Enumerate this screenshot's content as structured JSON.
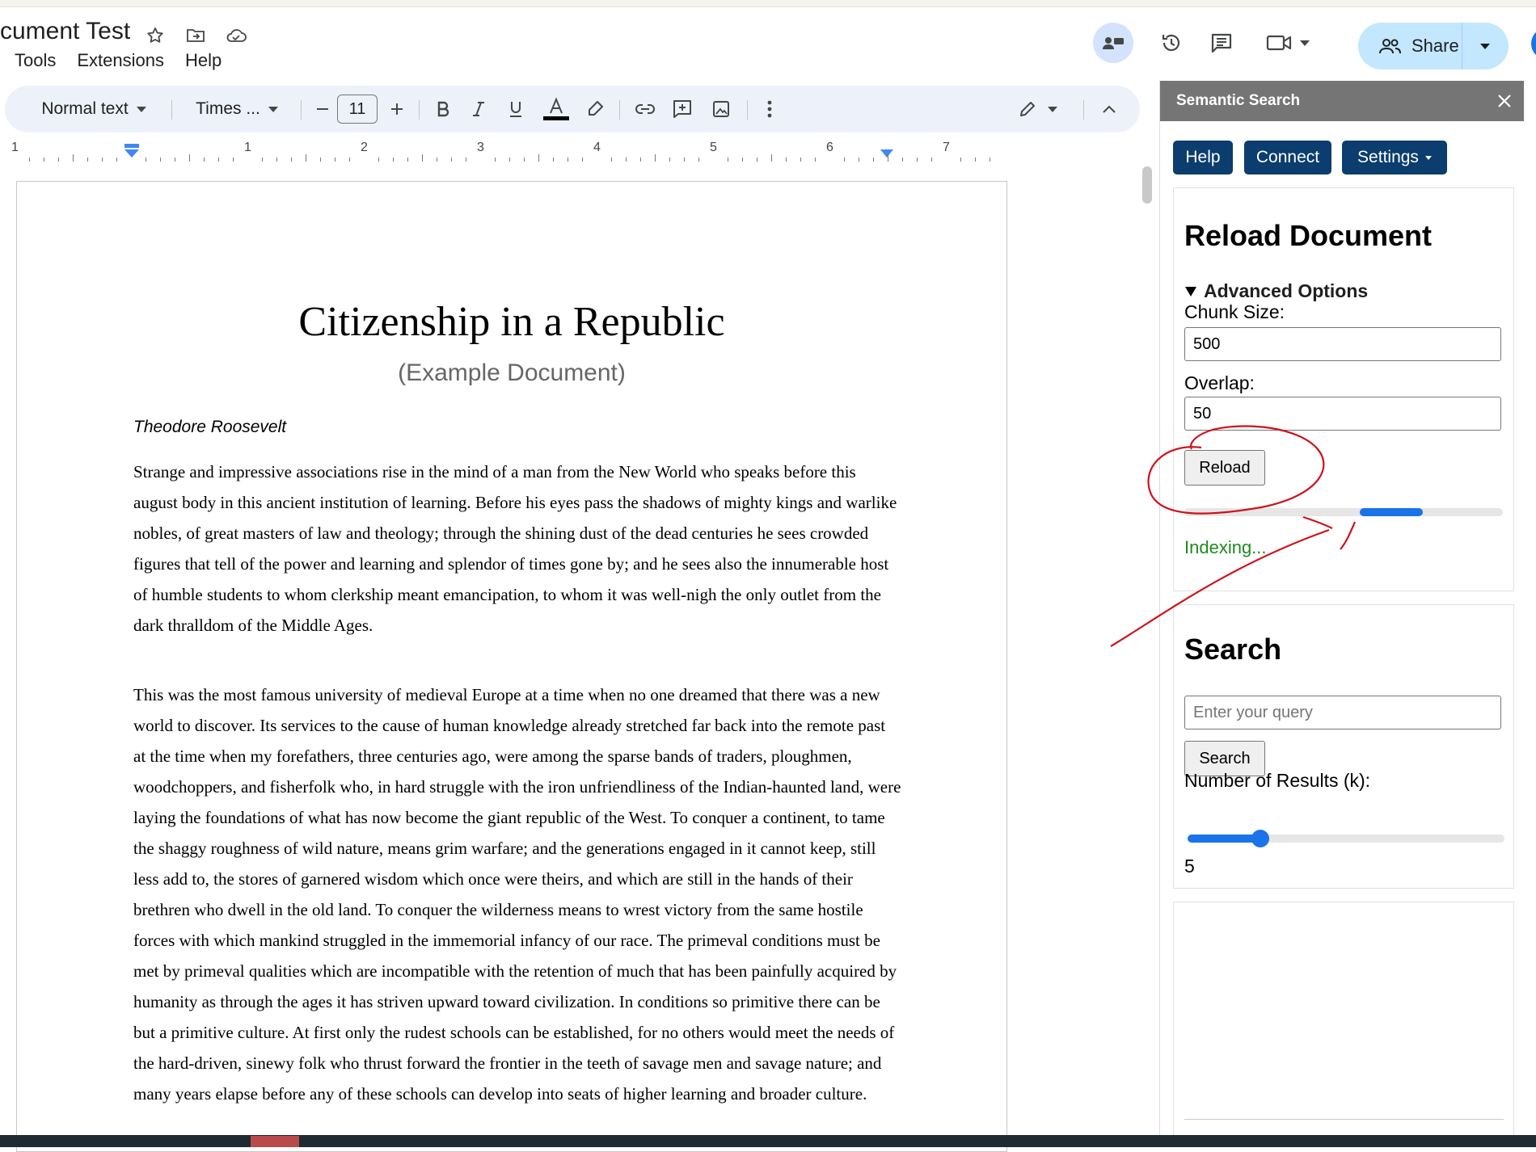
{
  "header": {
    "doc_title": "cument Test",
    "menu": [
      "Tools",
      "Extensions",
      "Help"
    ],
    "share_label": "Share"
  },
  "toolbar": {
    "style": "Normal text",
    "font": "Times ...",
    "font_size": "11"
  },
  "ruler": {
    "marks": [
      "1",
      "1",
      "2",
      "3",
      "4",
      "5",
      "6",
      "7"
    ]
  },
  "document": {
    "title": "Citizenship in a Republic",
    "subtitle": "(Example Document)",
    "author": "Theodore Roosevelt",
    "paragraphs": [
      "Strange and impressive associations rise in the mind of a man from the New World who speaks before this august body in this ancient institution of learning. Before his eyes pass the shadows of mighty kings and warlike nobles, of great masters of law and theology; through the shining dust of the dead centuries he sees crowded figures that tell of the power and learning and splendor of times gone by; and he sees also the innumerable host of humble students to whom clerkship meant emancipation, to whom it was well-nigh the only outlet from the dark thralldom of the Middle Ages.",
      "This was the most famous university of medieval Europe at a time when no one dreamed that there was a new world to discover. Its services to the cause of human knowledge already stretched far back into the remote past at the time when my forefathers, three centuries ago, were among the sparse bands of traders, ploughmen, woodchoppers, and fisherfolk who, in hard struggle with the iron unfriendliness of the Indian-haunted land, were laying the foundations of what has now become the giant republic of the West. To conquer a continent, to tame the shaggy roughness of wild nature, means grim warfare; and the generations engaged in it cannot keep, still less add to, the stores of garnered wisdom which once were theirs, and which are still in the hands of their brethren who dwell in the old land. To conquer the wilderness means to wrest victory from the same hostile forces with which mankind struggled in the immemorial infancy of our race. The primeval conditions must be met by primeval qualities which are incompatible with the retention of much that has been painfully acquired by humanity as through the ages it has striven upward toward civilization. In conditions so primitive there can be but a primitive culture. At first only the rudest schools can be established, for no others would meet the needs of the hard-driven, sinewy folk who thrust forward the frontier in the teeth of savage men and savage nature; and many years elapse before any of these schools can develop into seats of higher learning and broader culture."
    ]
  },
  "panel": {
    "title": "Semantic Search",
    "buttons": {
      "help": "Help",
      "connect": "Connect",
      "settings": "Settings"
    },
    "reload": {
      "heading": "Reload Document",
      "advanced": "Advanced Options",
      "chunk_label": "Chunk Size:",
      "chunk_value": "500",
      "overlap_label": "Overlap:",
      "overlap_value": "50",
      "button": "Reload",
      "status": "Indexing...",
      "progress_from": 0.55,
      "progress_to": 0.75
    },
    "search": {
      "heading": "Search",
      "placeholder": "Enter your query",
      "button": "Search",
      "k_label": "Number of Results (k):",
      "k_value": "5",
      "k_fraction": 0.23
    }
  },
  "colors": {
    "panel_header": "#757575",
    "panel_button": "#0b3d6e",
    "progress": "#1a73e8",
    "status_text": "#1e8a1e",
    "annotation": "#d0111b"
  }
}
